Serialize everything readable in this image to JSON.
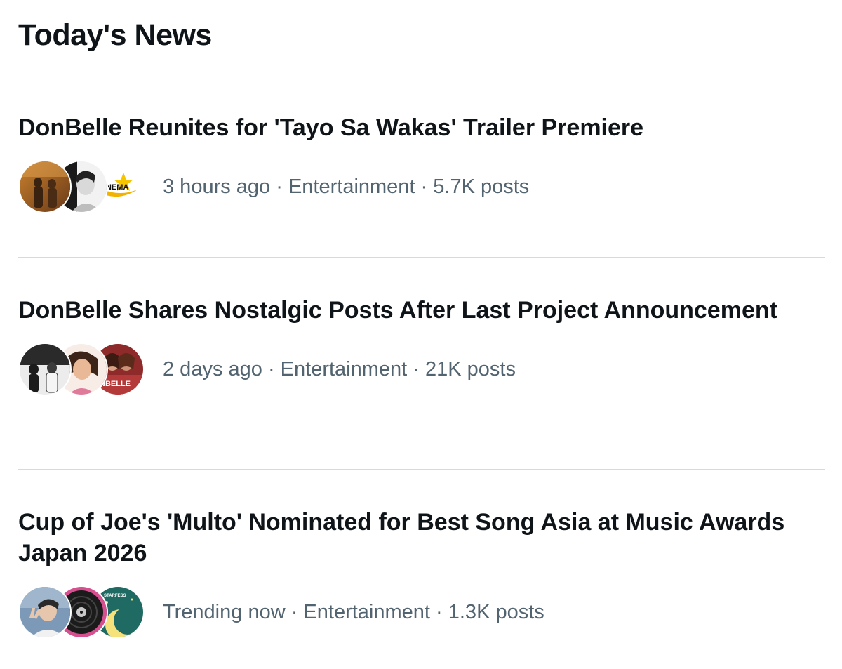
{
  "section": {
    "title": "Today's News"
  },
  "news": [
    {
      "headline": "DonBelle Reunites for 'Tayo Sa Wakas' Trailer Premiere",
      "time": "3 hours ago",
      "category": "Entertainment",
      "posts": "5.7K posts",
      "avatars": [
        "couple-photo-avatar",
        "portrait-photo-avatar",
        "cinema-logo-avatar"
      ],
      "avatar_logo_text": "CINEMA"
    },
    {
      "headline": "DonBelle Shares Nostalgic Posts After Last Project Announcement",
      "time": "2 days ago",
      "category": "Entertainment",
      "posts": "21K posts",
      "avatars": [
        "bw-group-photo-avatar",
        "child-photo-avatar",
        "donbelle-fan-avatar"
      ],
      "avatar_logo_text": "NBELLE"
    },
    {
      "headline": "Cup of Joe's 'Multo' Nominated for Best Song Asia at Music Awards Japan 2026",
      "time": "Trending now",
      "category": "Entertainment",
      "posts": "1.3K posts",
      "avatars": [
        "peace-sign-portrait-avatar",
        "vinyl-record-avatar",
        "moon-night-avatar"
      ],
      "avatar_logo_text": "STARFESS"
    }
  ],
  "separator": " · ",
  "colors": {
    "text_primary": "#0f1419",
    "text_secondary": "#536471",
    "divider": "#d6dadd"
  }
}
